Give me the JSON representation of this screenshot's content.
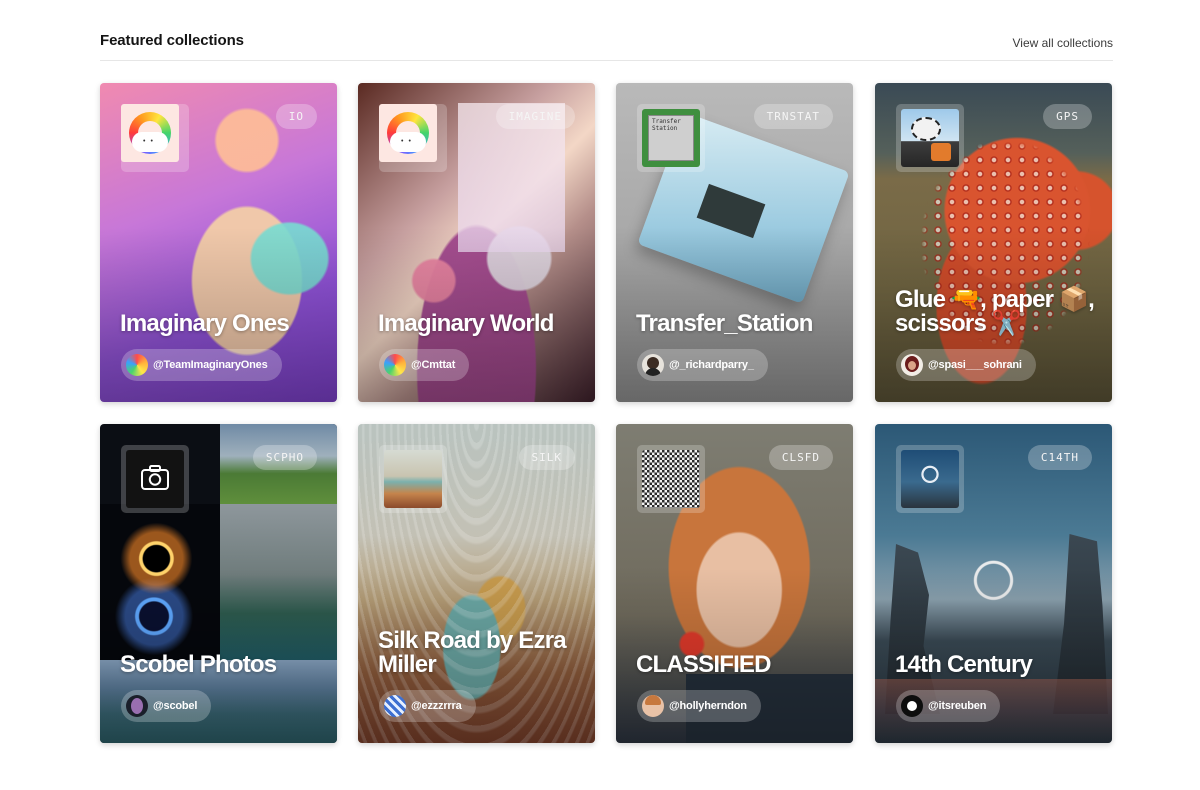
{
  "section": {
    "title": "Featured collections",
    "view_all": "View all collections"
  },
  "collections": [
    {
      "title": "Imaginary Ones",
      "ticker": "IO",
      "owner": "@TeamImaginaryOnes",
      "thumb_icon": "rainbow-icon"
    },
    {
      "title": "Imaginary World",
      "ticker": "IMAGINE",
      "owner": "@Cmttat",
      "thumb_icon": "rainbow-icon"
    },
    {
      "title": "Transfer_Station",
      "ticker": "TRNSTAT",
      "owner": "@_richardparry_",
      "thumb_icon": "chip-icon",
      "thumb_text": "Transfer Station"
    },
    {
      "title": "Glue 🔫, paper 📦, scissors ✂️",
      "ticker": "GPS",
      "owner": "@spasi___sohrani",
      "thumb_icon": "collage-icon"
    },
    {
      "title": "Scobel Photos",
      "ticker": "SCPHO",
      "owner": "@scobel",
      "thumb_icon": "camera-icon"
    },
    {
      "title": "Silk Road by Ezra Miller",
      "ticker": "SILK",
      "owner": "@ezzzrrra",
      "thumb_icon": "landscape-icon"
    },
    {
      "title": "CLASSIFIED",
      "ticker": "CLSFD",
      "owner": "@hollyherndon",
      "thumb_icon": "noise-icon"
    },
    {
      "title": "14th Century",
      "ticker": "C14TH",
      "owner": "@itsreuben",
      "thumb_icon": "portal-icon"
    }
  ]
}
